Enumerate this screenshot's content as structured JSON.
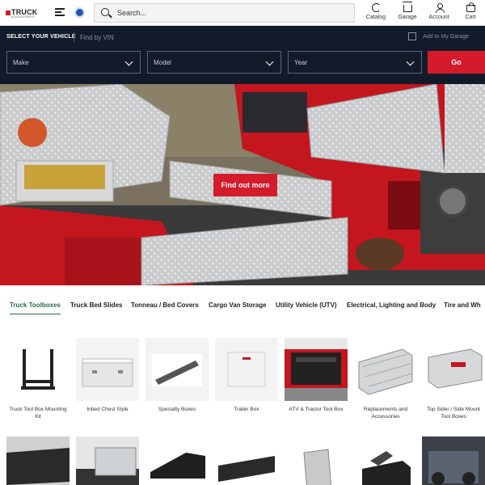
{
  "header": {
    "logo_text": "TRUCK",
    "logo_sub": "ACCESSORIES",
    "search_placeholder": "Search...",
    "nav": [
      {
        "label": "Catalog",
        "icon": "catalog-icon"
      },
      {
        "label": "Garage",
        "icon": "garage-icon"
      },
      {
        "label": "Account",
        "icon": "account-icon"
      },
      {
        "label": "Cart",
        "icon": "cart-icon"
      }
    ]
  },
  "vehicle_selector": {
    "title": "SELECT YOUR VEHICLE",
    "find_vin": "Find by VIN",
    "add_garage": "Add to My Garage",
    "make": "Make",
    "model": "Model",
    "year": "Year",
    "go": "Go"
  },
  "hero": {
    "cta": "Find out more"
  },
  "tabs": [
    "Truck Toolboxes",
    "Truck Bed Slides",
    "Tonneau / Bed Covers",
    "Cargo Van Storage",
    "Utility Vehicle (UTV)",
    "Electrical, Lighting and Body",
    "Tire and Wh"
  ],
  "products": [
    "Truck Tool Box Mounting Kit",
    "Inbed Chest Style",
    "Specialty Boxes",
    "Trailer Box",
    "ATV & Tractor Tool Box",
    "Replacements and Accessories",
    "Top Sider / Side Mount Tool Boxes"
  ],
  "colors": {
    "accent_red": "#d41b2c",
    "selector_bg": "#131a2a",
    "active_tab": "#2a6b4a"
  }
}
